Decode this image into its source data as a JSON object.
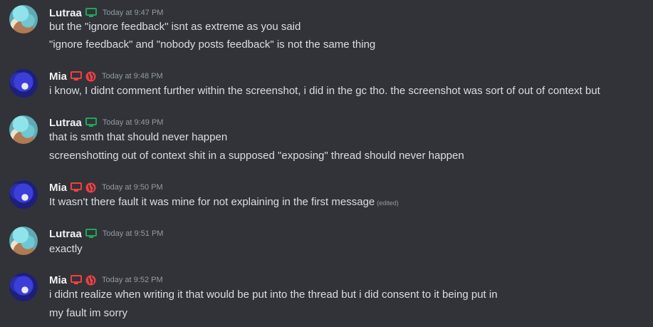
{
  "colors": {
    "background": "#313338",
    "text": "#dbdee1",
    "username": "#f2f3f5",
    "timestamp": "#949ba4",
    "desktop_green": "#23a55a",
    "desktop_red": "#f23f43"
  },
  "messages": [
    {
      "author": "Lutraa",
      "timestamp": "Today at 9:47 PM",
      "icons": [
        "desktop-green-icon"
      ],
      "lines": [
        "but the \"ignore feedback\" isnt as extreme as you said",
        "\"ignore feedback\" and \"nobody posts feedback\" is not the same thing"
      ]
    },
    {
      "author": "Mia",
      "timestamp": "Today at 9:48 PM",
      "icons": [
        "desktop-red-icon",
        "globe-icon"
      ],
      "lines": [
        "i know, I didnt comment further within the screenshot, i did in the gc tho.  the screenshot was sort of out of context but"
      ]
    },
    {
      "author": "Lutraa",
      "timestamp": "Today at 9:49 PM",
      "icons": [
        "desktop-green-icon"
      ],
      "lines": [
        "that is smth that should never happen",
        "screenshotting out of context shit in a supposed \"exposing\" thread should never happen"
      ]
    },
    {
      "author": "Mia",
      "timestamp": "Today at 9:50 PM",
      "icons": [
        "desktop-red-icon",
        "globe-icon"
      ],
      "lines": [
        "It wasn't there fault it was mine for not explaining in the first message"
      ],
      "edited": "(edited)"
    },
    {
      "author": "Lutraa",
      "timestamp": "Today at 9:51 PM",
      "icons": [
        "desktop-green-icon"
      ],
      "lines": [
        "exactly"
      ]
    },
    {
      "author": "Mia",
      "timestamp": "Today at 9:52 PM",
      "icons": [
        "desktop-red-icon",
        "globe-icon"
      ],
      "lines": [
        "i didnt realize when writing it that would be put into the thread but i did consent to it being put in",
        "my fault im sorry"
      ]
    }
  ]
}
